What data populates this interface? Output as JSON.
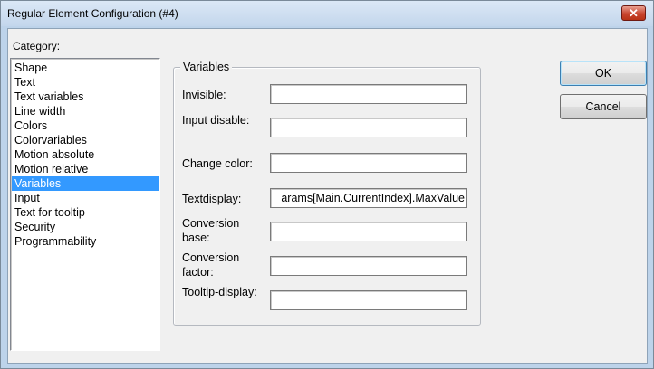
{
  "window": {
    "title": "Regular Element Configuration (#4)",
    "close_symbol": "✕"
  },
  "category": {
    "label": "Category:",
    "selected": "Variables",
    "items": [
      "Shape",
      "Text",
      "Text variables",
      "Line width",
      "Colors",
      "Colorvariables",
      "Motion absolute",
      "Motion relative",
      "Variables",
      "Input",
      "Text for tooltip",
      "Security",
      "Programmability"
    ]
  },
  "variables": {
    "group_title": "Variables",
    "fields": [
      {
        "label": "Invisible:",
        "value": ""
      },
      {
        "label": "Input disable:",
        "value": ""
      },
      {
        "label": "Change color:",
        "value": ""
      },
      {
        "label": "Textdisplay:",
        "value": "arams[Main.CurrentIndex].MaxValue"
      },
      {
        "label": "Conversion base:",
        "value": ""
      },
      {
        "label": "Conversion factor:",
        "value": ""
      },
      {
        "label": "Tooltip-display:",
        "value": ""
      }
    ]
  },
  "buttons": {
    "ok": "OK",
    "cancel": "Cancel"
  }
}
